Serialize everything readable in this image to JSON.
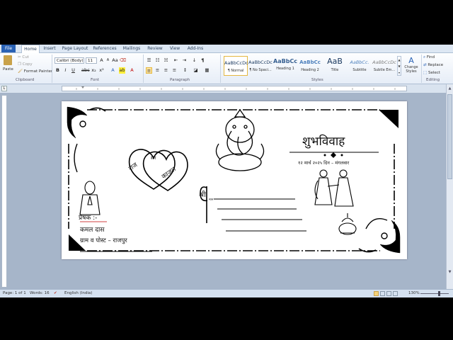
{
  "tabs": [
    "File",
    "Home",
    "Insert",
    "Page Layout",
    "References",
    "Mailings",
    "Review",
    "View",
    "Add-Ins"
  ],
  "clipboard": {
    "paste": "Paste",
    "cut": "Cut",
    "copy": "Copy",
    "format_painter": "Format Painter",
    "label": "Clipboard"
  },
  "font": {
    "name": "Calibri (Body)",
    "size": "11",
    "label": "Font"
  },
  "paragraph": {
    "label": "Paragraph"
  },
  "styles": {
    "items": [
      {
        "preview": "AaBbCcDc",
        "name": "¶ Normal"
      },
      {
        "preview": "AaBbCcDc",
        "name": "¶ No Spaci..."
      },
      {
        "preview": "AaBbCc",
        "name": "Heading 1"
      },
      {
        "preview": "AaBbCc",
        "name": "Heading 2"
      },
      {
        "preview": "AaB",
        "name": "Title"
      },
      {
        "preview": "AaBbCc.",
        "name": "Subtitle"
      },
      {
        "preview": "AaBbCcDc",
        "name": "Subtle Em..."
      }
    ],
    "change_styles": "Change Styles",
    "label": "Styles"
  },
  "editing": {
    "find": "Find",
    "replace": "Replace",
    "select": "Select",
    "label": "Editing"
  },
  "card": {
    "heading": "शुभविवाह",
    "date_line": "१२ मार्च २०२५ दिन – मंगलवार",
    "heart_left": "राज",
    "heart_mid": "संग",
    "heart_right": "काजल",
    "shri": "श्री",
    "shri_suffix": "मान",
    "sender_label": "प्रेषक :-",
    "sender_name": "कमल दास",
    "sender_address": "ग्राम व पोस्ट – राजपुर"
  },
  "status": {
    "page": "Page: 1 of 1",
    "words": "Words: 16",
    "language": "English (India)",
    "zoom": "130%"
  },
  "colors": {
    "ribbon_blue": "#2a62b5",
    "accent_gold": "#e5b840"
  }
}
